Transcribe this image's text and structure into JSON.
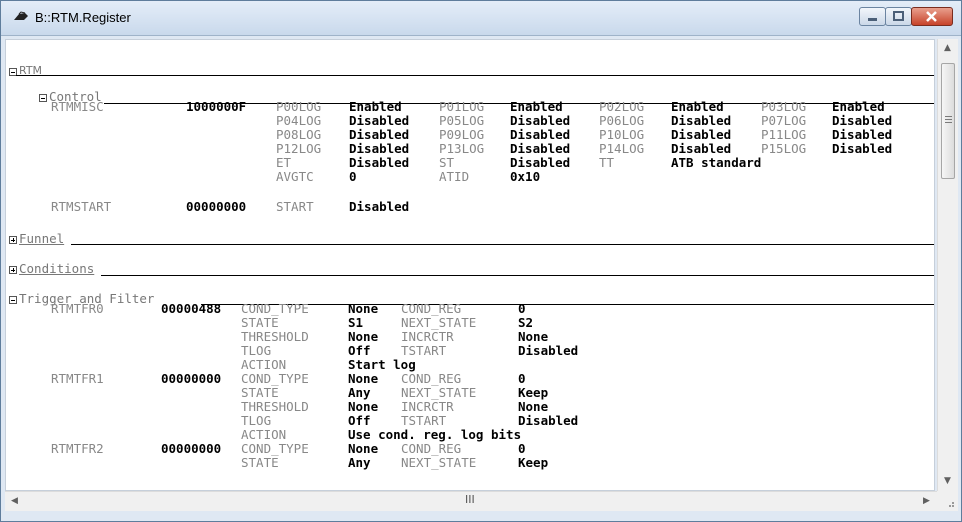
{
  "window": {
    "title": "B::RTM.Register"
  },
  "sections": {
    "rtm": "RTM",
    "control": "Control",
    "funnel": "Funnel",
    "conditions": "Conditions",
    "trigger": "Trigger and Filter"
  },
  "control": {
    "rtmmisc": {
      "name": "RTMMISC",
      "value": "1000000F",
      "fields": [
        [
          "P00LOG",
          "Enabled",
          "P01LOG",
          "Enabled",
          "P02LOG",
          "Enabled",
          "P03LOG",
          "Enabled"
        ],
        [
          "P04LOG",
          "Disabled",
          "P05LOG",
          "Disabled",
          "P06LOG",
          "Disabled",
          "P07LOG",
          "Disabled"
        ],
        [
          "P08LOG",
          "Disabled",
          "P09LOG",
          "Disabled",
          "P10LOG",
          "Disabled",
          "P11LOG",
          "Disabled"
        ],
        [
          "P12LOG",
          "Disabled",
          "P13LOG",
          "Disabled",
          "P14LOG",
          "Disabled",
          "P15LOG",
          "Disabled"
        ],
        [
          "ET",
          "Disabled",
          "ST",
          "Disabled",
          "TT",
          "ATB standard",
          "",
          ""
        ],
        [
          "AVGTC",
          "0",
          "ATID",
          "0x10",
          "",
          "",
          "",
          ""
        ]
      ]
    },
    "rtmstart": {
      "name": "RTMSTART",
      "value": "00000000",
      "field": "START",
      "field_value": "Disabled"
    }
  },
  "trigger": [
    {
      "name": "RTMTFR0",
      "value": "00000488",
      "rows": [
        [
          "COND_TYPE",
          "None",
          "COND_REG",
          "0"
        ],
        [
          "STATE",
          "S1",
          "NEXT_STATE",
          "S2"
        ],
        [
          "THRESHOLD",
          "None",
          "INCRCTR",
          "None"
        ],
        [
          "TLOG",
          "Off",
          "TSTART",
          "Disabled"
        ],
        [
          "ACTION",
          "Start log",
          "",
          ""
        ]
      ]
    },
    {
      "name": "RTMTFR1",
      "value": "00000000",
      "rows": [
        [
          "COND_TYPE",
          "None",
          "COND_REG",
          "0"
        ],
        [
          "STATE",
          "Any",
          "NEXT_STATE",
          "Keep"
        ],
        [
          "THRESHOLD",
          "None",
          "INCRCTR",
          "None"
        ],
        [
          "TLOG",
          "Off",
          "TSTART",
          "Disabled"
        ],
        [
          "ACTION",
          "Use cond. reg. log bits",
          "",
          ""
        ]
      ]
    },
    {
      "name": "RTMTFR2",
      "value": "00000000",
      "rows": [
        [
          "COND_TYPE",
          "None",
          "COND_REG",
          "0"
        ],
        [
          "STATE",
          "Any",
          "NEXT_STATE",
          "Keep"
        ]
      ]
    }
  ],
  "scrollbars": {
    "h_grip": "III"
  }
}
